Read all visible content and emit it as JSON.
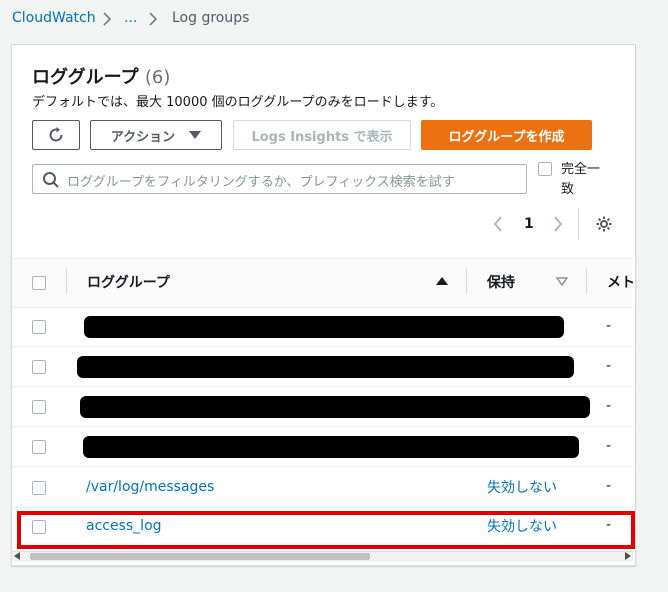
{
  "breadcrumb": {
    "items": [
      "CloudWatch",
      "...",
      "Log groups"
    ]
  },
  "panel": {
    "title": "ロググループ",
    "count": "(6)",
    "description": "デフォルトでは、最大 10000 個のロググループのみをロードします。"
  },
  "toolbar": {
    "actions_label": "アクション",
    "insights_label": "Logs Insights で表示",
    "create_label": "ロググループを作成"
  },
  "search": {
    "placeholder": "ロググループをフィルタリングするか、プレフィックス検索を試す",
    "exact_match_line1": "完全一",
    "exact_match_line2": "致"
  },
  "pagination": {
    "current_page": "1"
  },
  "table": {
    "columns": [
      "ロググループ",
      "保持",
      "メト"
    ],
    "rows": [
      {
        "name": "",
        "retention": "",
        "metric": "-",
        "redacted": true
      },
      {
        "name": "",
        "retention": "",
        "metric": "-",
        "redacted": true
      },
      {
        "name": "",
        "retention": "",
        "metric": "-",
        "redacted": true
      },
      {
        "name": "",
        "retention": "",
        "metric": "-",
        "redacted": true
      },
      {
        "name": "/var/log/messages",
        "retention": "失効しない",
        "metric": "-",
        "redacted": false
      },
      {
        "name": "access_log",
        "retention": "失効しない",
        "metric": "-",
        "redacted": false,
        "highlighted": true
      }
    ]
  },
  "colors": {
    "link": "#0073bb",
    "primary": "#ec7211",
    "highlight": "#e10000"
  }
}
